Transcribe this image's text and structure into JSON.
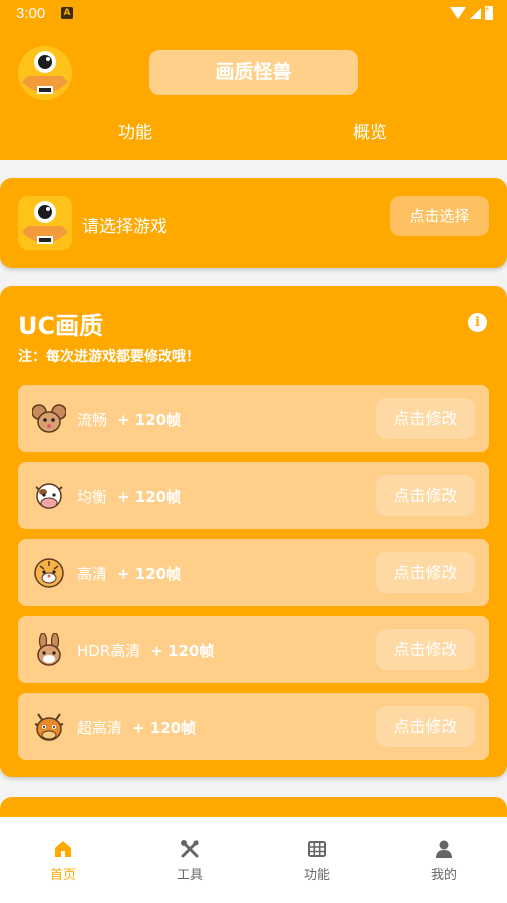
{
  "status": {
    "time": "3:00",
    "a_badge": "A"
  },
  "header": {
    "title": "画质怪兽",
    "tabs": [
      "功能",
      "概览"
    ]
  },
  "select_card": {
    "label": "请选择游戏",
    "button": "点击选择"
  },
  "uc": {
    "title": "UC画质",
    "note": "注：每次进游戏都要修改哦！",
    "rows": [
      {
        "name": "流畅",
        "fps": "+ 120帧",
        "button": "点击修改",
        "icon": "mouse-icon"
      },
      {
        "name": "均衡",
        "fps": "+ 120帧",
        "button": "点击修改",
        "icon": "cow-icon"
      },
      {
        "name": "高清",
        "fps": "+ 120帧",
        "button": "点击修改",
        "icon": "tiger-icon"
      },
      {
        "name": "HDR高清",
        "fps": "+ 120帧",
        "button": "点击修改",
        "icon": "rabbit-icon"
      },
      {
        "name": "超高清",
        "fps": "+ 120帧",
        "button": "点击修改",
        "icon": "dragon-icon"
      }
    ]
  },
  "nav": {
    "items": [
      {
        "label": "首页",
        "icon": "home-icon"
      },
      {
        "label": "工具",
        "icon": "tools-icon"
      },
      {
        "label": "功能",
        "icon": "grid-icon"
      },
      {
        "label": "我的",
        "icon": "person-icon"
      }
    ]
  },
  "colors": {
    "accent": "#ffa800",
    "background": "#f3f3f3"
  }
}
